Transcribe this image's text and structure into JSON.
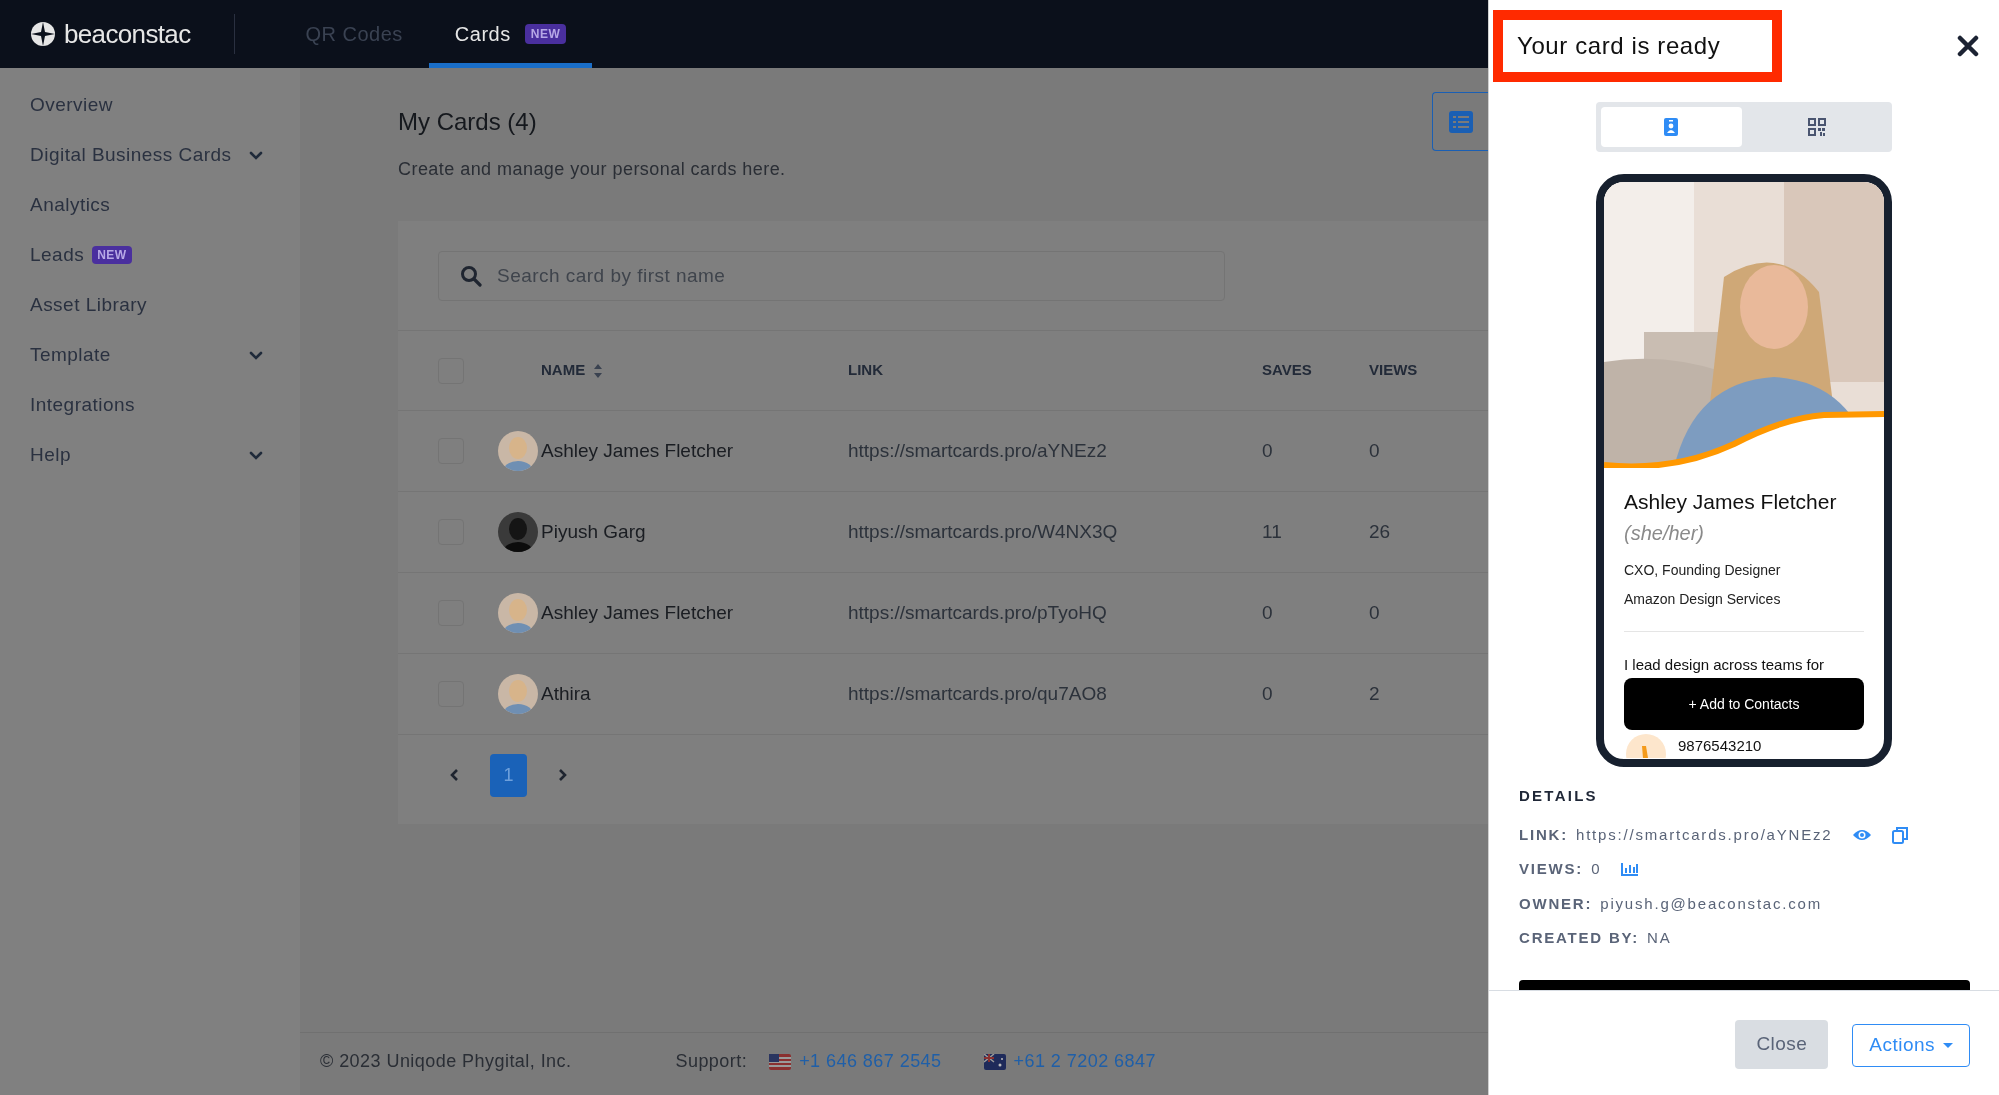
{
  "header": {
    "logo": "beaconstac",
    "tabs": [
      {
        "label": "QR Codes",
        "selected": false
      },
      {
        "label": "Cards",
        "selected": true,
        "badge": "NEW"
      }
    ]
  },
  "sidebar": {
    "items": [
      {
        "label": "Overview",
        "expandable": false
      },
      {
        "label": "Digital Business Cards",
        "expandable": true
      },
      {
        "label": "Analytics",
        "expandable": false
      },
      {
        "label": "Leads",
        "expandable": false,
        "badge": "NEW"
      },
      {
        "label": "Asset Library",
        "expandable": false
      },
      {
        "label": "Template",
        "expandable": true
      },
      {
        "label": "Integrations",
        "expandable": false
      },
      {
        "label": "Help",
        "expandable": true
      }
    ]
  },
  "page": {
    "title": "My Cards (4)",
    "subtitle": "Create and manage your personal cards here.",
    "search": {
      "placeholder": "Search card by first name"
    }
  },
  "table": {
    "columns": [
      {
        "label": "NAME",
        "sortable": true
      },
      {
        "label": "LINK",
        "sortable": false
      },
      {
        "label": "SAVES",
        "sortable": false
      },
      {
        "label": "VIEWS",
        "sortable": false
      }
    ],
    "select_all": {
      "checked": false
    },
    "rows": [
      {
        "checked": false,
        "kind": "light",
        "name": "Ashley James Fletcher",
        "link": "https://smartcards.pro/aYNEz2",
        "saves": "0",
        "views": "0"
      },
      {
        "checked": false,
        "kind": "dark",
        "name": "Piyush Garg",
        "link": "https://smartcards.pro/W4NX3Q",
        "saves": "11",
        "views": "26"
      },
      {
        "checked": false,
        "kind": "light",
        "name": "Ashley James Fletcher",
        "link": "https://smartcards.pro/pTyoHQ",
        "saves": "0",
        "views": "0"
      },
      {
        "checked": false,
        "kind": "light",
        "name": "Athira",
        "link": "https://smartcards.pro/qu7AO8",
        "saves": "0",
        "views": "2"
      }
    ]
  },
  "pagination": {
    "pages": [
      {
        "label": "1",
        "selected": true
      }
    ]
  },
  "footer": {
    "copyright": "© 2023 Uniqode Phygital, Inc.",
    "support_label": "Support:",
    "phones": [
      {
        "kind": "us",
        "number": "+1 646 867 2545"
      },
      {
        "kind": "au",
        "number": "+61 2 7202 6847"
      }
    ]
  },
  "drawer": {
    "title": "Your card is ready",
    "view_toggle": [
      {
        "kind": "card",
        "selected": true
      },
      {
        "kind": "qr",
        "selected": false
      }
    ],
    "card": {
      "name": "Ashley James Fletcher",
      "pronouns": "(she/her)",
      "job_title": "CXO, Founding Designer",
      "company": "Amazon Design Services",
      "bio": "I lead design across teams for",
      "button": "+ Add to Contacts",
      "phone": "9876543210"
    },
    "details_heading": "DETAILS",
    "details": [
      {
        "kind": "link",
        "label": "LINK:",
        "value": "https://smartcards.pro/aYNEz2"
      },
      {
        "kind": "views",
        "label": "VIEWS:",
        "value": "0"
      },
      {
        "kind": "text",
        "label": "OWNER:",
        "value": "piyush.g@beaconstac.com"
      },
      {
        "kind": "text",
        "label": "CREATED BY:",
        "value": "NA"
      }
    ],
    "buttons": [
      {
        "kind": "secondary",
        "label": "Close"
      },
      {
        "kind": "dropdown",
        "label": "Actions"
      }
    ]
  }
}
